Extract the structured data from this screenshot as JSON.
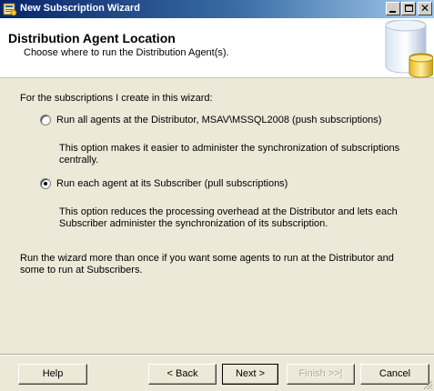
{
  "window": {
    "title": "New Subscription Wizard",
    "controls": {
      "minimize": "minimize-icon",
      "maximize": "maximize-icon",
      "close": "✕"
    }
  },
  "header": {
    "title": "Distribution Agent Location",
    "subtitle": "Choose where to run the Distribution Agent(s)."
  },
  "content": {
    "intro": "For the subscriptions I create in this wizard:",
    "options": [
      {
        "label": "Run all agents at the Distributor, MSAV\\MSSQL2008 (push subscriptions)",
        "description": "This option makes it easier to administer the synchronization of subscriptions centrally.",
        "selected": false
      },
      {
        "label": "Run each agent at its Subscriber (pull subscriptions)",
        "description": "This option reduces the processing overhead at the Distributor and lets each Subscriber administer the synchronization of its subscription.",
        "selected": true
      }
    ],
    "note": "Run the wizard more than once if you want some agents to run at the Distributor and some to run at Subscribers."
  },
  "buttons": {
    "help": "Help",
    "back": "< Back",
    "next": "Next >",
    "finish": "Finish >>|",
    "cancel": "Cancel"
  },
  "colors": {
    "titlebar_start": "#0a246a",
    "titlebar_end": "#a6caf0",
    "dialog_bg": "#ece9d8",
    "header_bg": "#ffffff"
  }
}
